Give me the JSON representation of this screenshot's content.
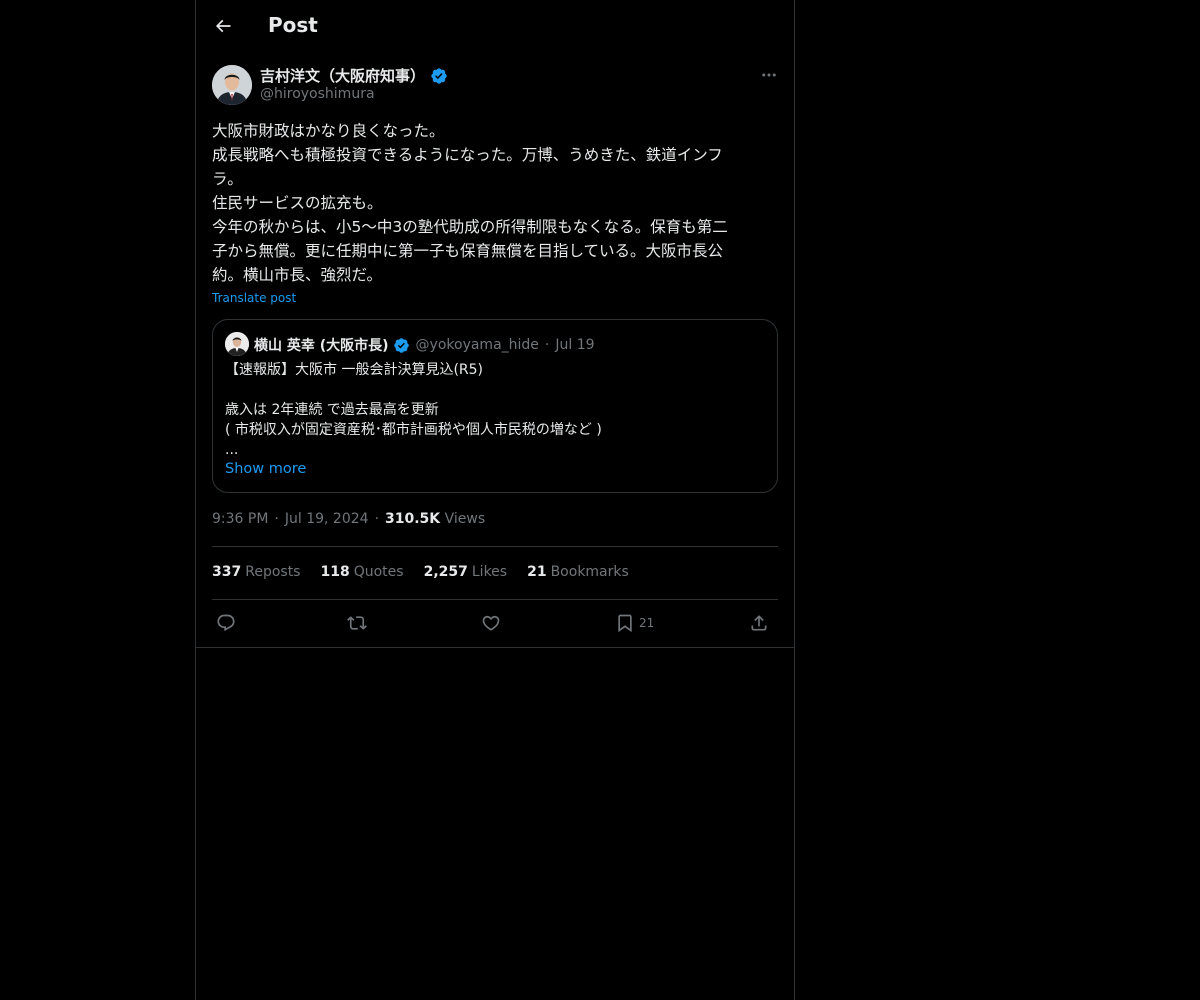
{
  "header": {
    "title": "Post",
    "back_icon": "arrow-left-icon"
  },
  "author": {
    "name": "吉村洋文（大阪府知事）",
    "handle": "@hiroyoshimura",
    "verified": true,
    "verified_color": "#1d9bf0"
  },
  "post": {
    "lines": [
      "大阪市財政はかなり良くなった。",
      "成長戦略へも積極投資できるようになった。万博、うめきた、鉄道インフ",
      "ラ。",
      "住民サービスの拡充も。",
      "今年の秋からは、小5〜中3の塾代助成の所得制限もなくなる。保育も第二",
      "子から無償。更に任期中に第一子も保育無償を目指している。大阪市長公",
      "約。横山市長、強烈だ。"
    ],
    "translate_label": "Translate post"
  },
  "quote": {
    "name": "横山 英幸 (大阪市長)",
    "handle": "@yokoyama_hide",
    "dot": "·",
    "date": "Jul 19",
    "lines": [
      "【速報版】大阪市 一般会計決算見込(R5)",
      "",
      "歳入は 2年連続 で過去最高を更新",
      "( 市税収入が固定資産税･都市計画税や個人市民税の増など )",
      "..."
    ],
    "show_more": "Show more"
  },
  "meta": {
    "time": "9:36 PM",
    "sep1": "·",
    "date": "Jul 19, 2024",
    "sep2": "·",
    "views_count": "310.5K",
    "views_label": "Views"
  },
  "stats": {
    "reposts_count": "337",
    "reposts_label": "Reposts",
    "quotes_count": "118",
    "quotes_label": "Quotes",
    "likes_count": "2,257",
    "likes_label": "Likes",
    "bookmarks_count": "21",
    "bookmarks_label": "Bookmarks"
  },
  "actions": {
    "reply_icon": "reply-icon",
    "repost_icon": "repost-icon",
    "like_icon": "heart-icon",
    "bookmark_icon": "bookmark-icon",
    "bookmark_count": "21",
    "share_icon": "share-icon"
  },
  "colors": {
    "background": "#000000",
    "text": "#e7e9ea",
    "muted": "#71767b",
    "accent": "#1d9bf0",
    "border": "#2f3336"
  }
}
